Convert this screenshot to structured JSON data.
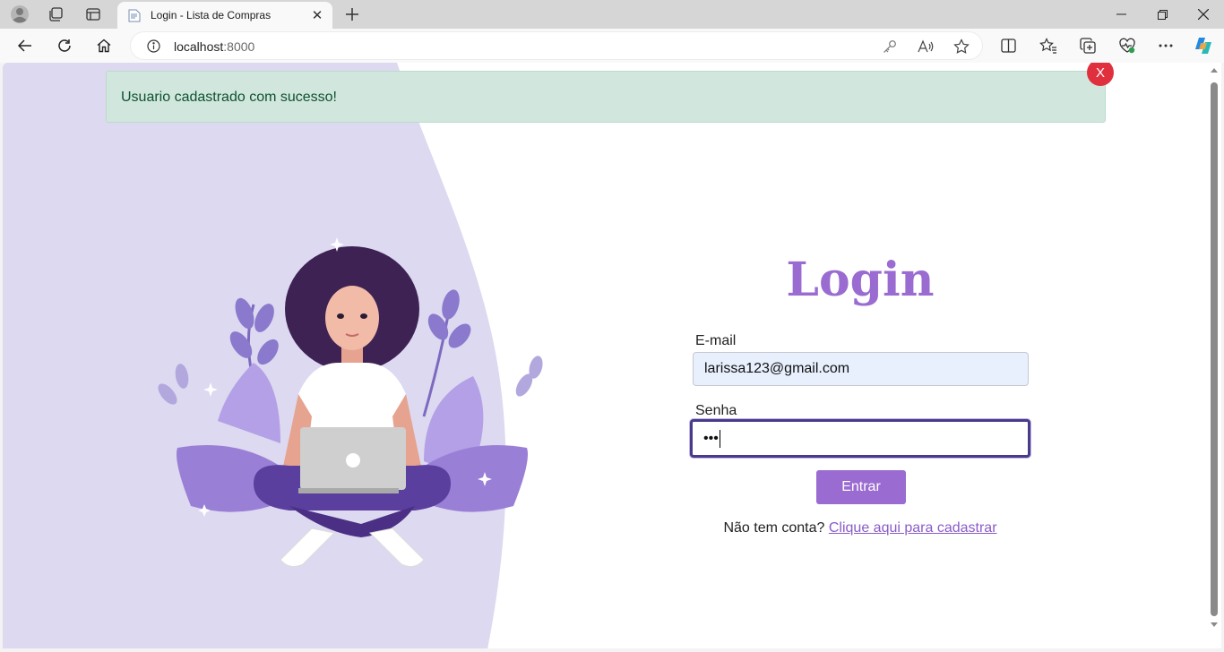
{
  "browser": {
    "tab": {
      "title": "Login - Lista de Compras"
    },
    "address": {
      "host": "localhost",
      "port": ":8000"
    }
  },
  "page": {
    "alert": {
      "message": "Usuario cadastrado com sucesso!",
      "close_label": "X"
    },
    "login": {
      "title": "Login",
      "email_label": "E-mail",
      "email_value": "larissa123@gmail.com",
      "password_label": "Senha",
      "password_mask": "•••",
      "submit_label": "Entrar",
      "signup_prompt": "Não tem conta? ",
      "signup_link": "Clique aqui para cadastrar"
    }
  },
  "colors": {
    "accent": "#9a6bd0",
    "left_panel": "#dcd9f0",
    "alert_bg": "#d1e7dd",
    "alert_text": "#0f5132",
    "alert_close": "#e0303e"
  },
  "icons": [
    "profile-icon",
    "workspaces-icon",
    "tab-actions-icon",
    "page-favicon",
    "close-icon",
    "plus-icon",
    "minimize-icon",
    "restore-icon",
    "window-close-icon",
    "back-icon",
    "refresh-icon",
    "home-icon",
    "info-icon",
    "key-icon",
    "read-aloud-icon",
    "favorite-star-icon",
    "split-screen-icon",
    "favorites-icon",
    "collections-icon",
    "browser-essentials-icon",
    "more-icon",
    "copilot-icon"
  ]
}
